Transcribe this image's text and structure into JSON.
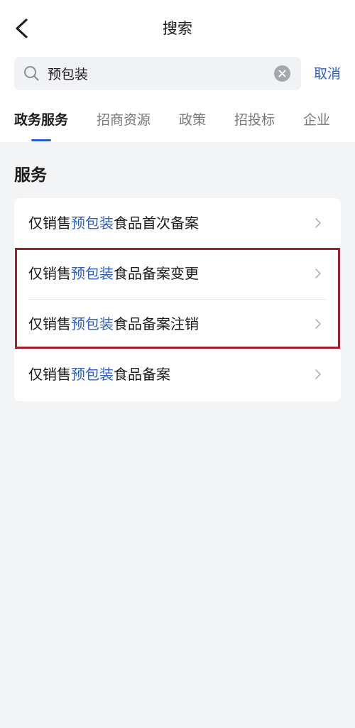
{
  "header": {
    "title": "搜索",
    "back_icon": "chevron-left-icon"
  },
  "search": {
    "value": "预包装",
    "cancel_label": "取消",
    "search_icon": "search-icon",
    "clear_icon": "clear-icon"
  },
  "tabs": [
    {
      "label": "政务服务",
      "active": true
    },
    {
      "label": "招商资源",
      "active": false
    },
    {
      "label": "政策",
      "active": false
    },
    {
      "label": "招投标",
      "active": false
    },
    {
      "label": "企业",
      "active": false
    }
  ],
  "section": {
    "title": "服务"
  },
  "results": [
    {
      "prefix": "仅销售",
      "highlight": "预包装",
      "suffix": "食品首次备案"
    },
    {
      "prefix": "仅销售",
      "highlight": "预包装",
      "suffix": "食品备案变更"
    },
    {
      "prefix": "仅销售",
      "highlight": "预包装",
      "suffix": "食品备案注销"
    },
    {
      "prefix": "仅销售",
      "highlight": "预包装",
      "suffix": "食品备案"
    }
  ],
  "colors": {
    "accent": "#2b5fc7",
    "annotation_frame": "#a21f2b",
    "background": "#f3f4f6"
  }
}
